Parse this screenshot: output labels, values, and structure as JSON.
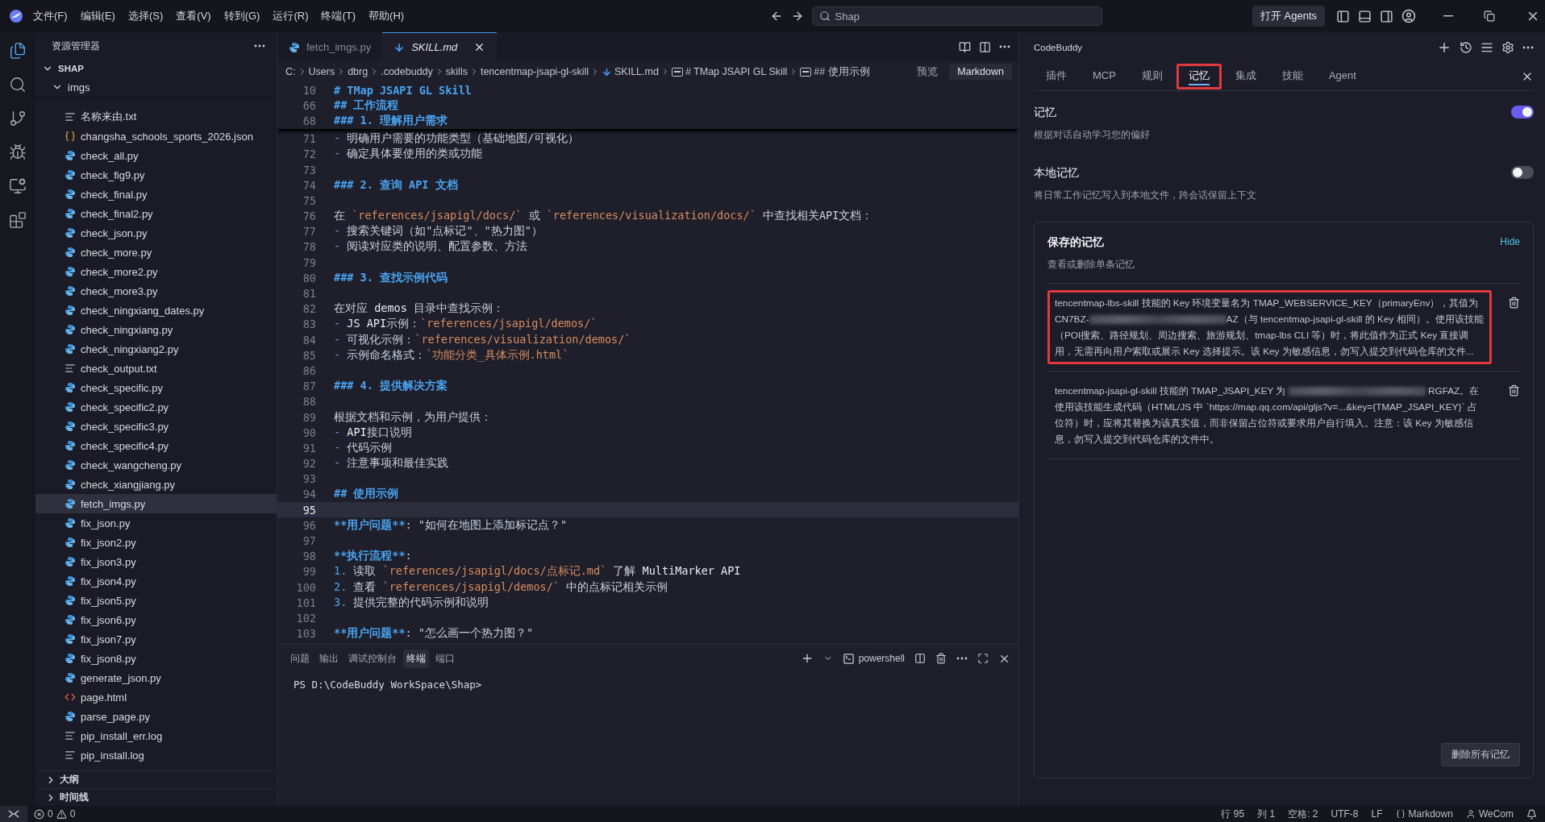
{
  "title_bar": {
    "menu": [
      "文件(F)",
      "编辑(E)",
      "选择(S)",
      "查看(V)",
      "转到(G)",
      "运行(R)",
      "终端(T)",
      "帮助(H)"
    ],
    "search": "Shap",
    "agents_button": "打开 Agents"
  },
  "activity_bar": [
    {
      "kind": "explorer",
      "selected": true
    },
    {
      "kind": "search",
      "selected": false
    },
    {
      "kind": "source-control",
      "selected": false
    },
    {
      "kind": "debug",
      "selected": false
    },
    {
      "kind": "remote",
      "selected": false
    },
    {
      "kind": "extensions",
      "selected": false
    }
  ],
  "explorer": {
    "title": "资源管理器",
    "root": {
      "label": "SHAP",
      "expanded": true
    },
    "folder": {
      "label": "imgs",
      "expanded": true
    },
    "files": [
      {
        "name": "名称来由.txt",
        "kind": "txt",
        "selected": false
      },
      {
        "name": "changsha_schools_sports_2026.json",
        "kind": "json",
        "selected": false
      },
      {
        "name": "check_all.py",
        "kind": "py",
        "selected": false
      },
      {
        "name": "check_fig9.py",
        "kind": "py",
        "selected": false
      },
      {
        "name": "check_final.py",
        "kind": "py",
        "selected": false
      },
      {
        "name": "check_final2.py",
        "kind": "py",
        "selected": false
      },
      {
        "name": "check_json.py",
        "kind": "py",
        "selected": false
      },
      {
        "name": "check_more.py",
        "kind": "py",
        "selected": false
      },
      {
        "name": "check_more2.py",
        "kind": "py",
        "selected": false
      },
      {
        "name": "check_more3.py",
        "kind": "py",
        "selected": false
      },
      {
        "name": "check_ningxiang_dates.py",
        "kind": "py",
        "selected": false
      },
      {
        "name": "check_ningxiang.py",
        "kind": "py",
        "selected": false
      },
      {
        "name": "check_ningxiang2.py",
        "kind": "py",
        "selected": false
      },
      {
        "name": "check_output.txt",
        "kind": "txt",
        "selected": false
      },
      {
        "name": "check_specific.py",
        "kind": "py",
        "selected": false
      },
      {
        "name": "check_specific2.py",
        "kind": "py",
        "selected": false
      },
      {
        "name": "check_specific3.py",
        "kind": "py",
        "selected": false
      },
      {
        "name": "check_specific4.py",
        "kind": "py",
        "selected": false
      },
      {
        "name": "check_wangcheng.py",
        "kind": "py",
        "selected": false
      },
      {
        "name": "check_xiangjiang.py",
        "kind": "py",
        "selected": false
      },
      {
        "name": "fetch_imgs.py",
        "kind": "py",
        "selected": true
      },
      {
        "name": "fix_json.py",
        "kind": "py",
        "selected": false
      },
      {
        "name": "fix_json2.py",
        "kind": "py",
        "selected": false
      },
      {
        "name": "fix_json3.py",
        "kind": "py",
        "selected": false
      },
      {
        "name": "fix_json4.py",
        "kind": "py",
        "selected": false
      },
      {
        "name": "fix_json5.py",
        "kind": "py",
        "selected": false
      },
      {
        "name": "fix_json6.py",
        "kind": "py",
        "selected": false
      },
      {
        "name": "fix_json7.py",
        "kind": "py",
        "selected": false
      },
      {
        "name": "fix_json8.py",
        "kind": "py",
        "selected": false
      },
      {
        "name": "generate_json.py",
        "kind": "py",
        "selected": false
      },
      {
        "name": "page.html",
        "kind": "html",
        "selected": false
      },
      {
        "name": "parse_page.py",
        "kind": "py",
        "selected": false
      },
      {
        "name": "pip_install_err.log",
        "kind": "txt",
        "selected": false
      },
      {
        "name": "pip_install.log",
        "kind": "txt",
        "selected": false
      }
    ],
    "sections": [
      {
        "label": "大纲",
        "expanded": false
      },
      {
        "label": "时间线",
        "expanded": false
      }
    ]
  },
  "editor": {
    "tabs": [
      {
        "label": "fetch_imgs.py",
        "kind": "py",
        "selected": false
      },
      {
        "label": "SKILL.md",
        "kind": "md",
        "selected": true
      }
    ],
    "breadcrumb": [
      {
        "label": "C:",
        "kind": "plain"
      },
      {
        "label": "Users",
        "kind": "plain"
      },
      {
        "label": "dbrg",
        "kind": "plain"
      },
      {
        "label": ".codebuddy",
        "kind": "plain"
      },
      {
        "label": "skills",
        "kind": "plain"
      },
      {
        "label": "tencentmap-jsapi-gl-skill",
        "kind": "plain"
      },
      {
        "label": "SKILL.md",
        "kind": "md"
      },
      {
        "label": "# TMap JSAPI GL Skill",
        "kind": "symbol"
      },
      {
        "label": "## 使用示例",
        "kind": "symbol"
      }
    ],
    "preview_link": "预览",
    "mode_button": "Markdown",
    "sticky_lines": [
      {
        "number": "10",
        "segments": [
          {
            "kind": "heading",
            "text": "# TMap JSAPI GL Skill"
          }
        ]
      },
      {
        "number": "66",
        "segments": [
          {
            "kind": "heading",
            "text": "## 工作流程"
          }
        ]
      },
      {
        "number": "68",
        "segments": [
          {
            "kind": "heading",
            "text": "### 1. 理解用户需求"
          }
        ]
      }
    ],
    "lines": [
      {
        "number": "71",
        "segments": [
          {
            "kind": "marker",
            "text": "- "
          },
          {
            "kind": "plain",
            "text": "明确用户需要的功能类型（基础地图/可视化）"
          }
        ]
      },
      {
        "number": "72",
        "segments": [
          {
            "kind": "marker",
            "text": "- "
          },
          {
            "kind": "plain",
            "text": "确定具体要使用的类或功能"
          }
        ]
      },
      {
        "number": "73"
      },
      {
        "number": "74",
        "segments": [
          {
            "kind": "heading",
            "text": "### 2. 查询 API 文档"
          }
        ]
      },
      {
        "number": "75"
      },
      {
        "number": "76",
        "segments": [
          {
            "kind": "plain",
            "text": "在 "
          },
          {
            "kind": "code",
            "text": "`references/jsapigl/docs/`"
          },
          {
            "kind": "plain",
            "text": " 或 "
          },
          {
            "kind": "code",
            "text": "`references/visualization/docs/`"
          },
          {
            "kind": "plain",
            "text": " 中查找相关API文档："
          }
        ]
      },
      {
        "number": "77",
        "segments": [
          {
            "kind": "marker",
            "text": "- "
          },
          {
            "kind": "plain",
            "text": "搜索关键词（如\"点标记\"、\"热力图\"）"
          }
        ]
      },
      {
        "number": "78",
        "segments": [
          {
            "kind": "marker",
            "text": "- "
          },
          {
            "kind": "plain",
            "text": "阅读对应类的说明、配置参数、方法"
          }
        ]
      },
      {
        "number": "79"
      },
      {
        "number": "80",
        "segments": [
          {
            "kind": "heading",
            "text": "### 3. 查找示例代码"
          }
        ]
      },
      {
        "number": "81"
      },
      {
        "number": "82",
        "segments": [
          {
            "kind": "plain",
            "text": "在对应 "
          },
          {
            "kind": "mono",
            "text": "demos"
          },
          {
            "kind": "plain",
            "text": " 目录中查找示例："
          }
        ]
      },
      {
        "number": "83",
        "segments": [
          {
            "kind": "marker",
            "text": "- "
          },
          {
            "kind": "mono",
            "text": "JS API"
          },
          {
            "kind": "plain",
            "text": "示例："
          },
          {
            "kind": "code",
            "text": "`references/jsapigl/demos/`"
          }
        ]
      },
      {
        "number": "84",
        "segments": [
          {
            "kind": "marker",
            "text": "- "
          },
          {
            "kind": "plain",
            "text": "可视化示例："
          },
          {
            "kind": "code",
            "text": "`references/visualization/demos/`"
          }
        ]
      },
      {
        "number": "85",
        "segments": [
          {
            "kind": "marker",
            "text": "- "
          },
          {
            "kind": "plain",
            "text": "示例命名格式："
          },
          {
            "kind": "code",
            "text": "`功能分类_具体示例.html`"
          }
        ]
      },
      {
        "number": "86"
      },
      {
        "number": "87",
        "segments": [
          {
            "kind": "heading",
            "text": "### 4. 提供解决方案"
          }
        ]
      },
      {
        "number": "88"
      },
      {
        "number": "89",
        "segments": [
          {
            "kind": "plain",
            "text": "根据文档和示例，为用户提供："
          }
        ]
      },
      {
        "number": "90",
        "segments": [
          {
            "kind": "marker",
            "text": "- "
          },
          {
            "kind": "mono",
            "text": "API"
          },
          {
            "kind": "plain",
            "text": "接口说明"
          }
        ]
      },
      {
        "number": "91",
        "segments": [
          {
            "kind": "marker",
            "text": "- "
          },
          {
            "kind": "plain",
            "text": "代码示例"
          }
        ]
      },
      {
        "number": "92",
        "segments": [
          {
            "kind": "marker",
            "text": "- "
          },
          {
            "kind": "plain",
            "text": "注意事项和最佳实践"
          }
        ]
      },
      {
        "number": "93"
      },
      {
        "number": "94",
        "segments": [
          {
            "kind": "heading",
            "text": "## 使用示例"
          }
        ]
      },
      {
        "number": "95",
        "current": true
      },
      {
        "number": "96",
        "segments": [
          {
            "kind": "bold",
            "text": "**用户问题**"
          },
          {
            "kind": "plain",
            "text": ": \"如何在地图上添加标记点？\""
          }
        ]
      },
      {
        "number": "97"
      },
      {
        "number": "98",
        "segments": [
          {
            "kind": "bold",
            "text": "**执行流程**"
          },
          {
            "kind": "plain",
            "text": ":"
          }
        ]
      },
      {
        "number": "99",
        "segments": [
          {
            "kind": "marker",
            "text": "1. "
          },
          {
            "kind": "plain",
            "text": "读取 "
          },
          {
            "kind": "code",
            "text": "`references/jsapigl/docs/点标记.md`"
          },
          {
            "kind": "plain",
            "text": " 了解 "
          },
          {
            "kind": "mono",
            "text": "MultiMarker API"
          }
        ]
      },
      {
        "number": "100",
        "segments": [
          {
            "kind": "marker",
            "text": "2. "
          },
          {
            "kind": "plain",
            "text": "查看 "
          },
          {
            "kind": "code",
            "text": "`references/jsapigl/demos/`"
          },
          {
            "kind": "plain",
            "text": " 中的点标记相关示例"
          }
        ]
      },
      {
        "number": "101",
        "segments": [
          {
            "kind": "marker",
            "text": "3. "
          },
          {
            "kind": "plain",
            "text": "提供完整的代码示例和说明"
          }
        ]
      },
      {
        "number": "102"
      },
      {
        "number": "103",
        "segments": [
          {
            "kind": "bold",
            "text": "**用户问题**"
          },
          {
            "kind": "plain",
            "text": ": \"怎么画一个热力图？\""
          }
        ]
      }
    ]
  },
  "panel": {
    "tabs": [
      {
        "label": "问题",
        "selected": false
      },
      {
        "label": "输出",
        "selected": false
      },
      {
        "label": "调试控制台",
        "selected": false
      },
      {
        "label": "终端",
        "selected": true
      },
      {
        "label": "端口",
        "selected": false
      }
    ],
    "shell": "powershell",
    "prompt": "PS D:\\CodeBuddy WorkSpace\\Shap>"
  },
  "codebuddy": {
    "title": "CodeBuddy",
    "tabs": [
      {
        "label": "插件",
        "selected": false,
        "annotated": false
      },
      {
        "label": "MCP",
        "selected": false,
        "annotated": false
      },
      {
        "label": "规则",
        "selected": false,
        "annotated": false
      },
      {
        "label": "记忆",
        "selected": true,
        "annotated": true
      },
      {
        "label": "集成",
        "selected": false,
        "annotated": false
      },
      {
        "label": "技能",
        "selected": false,
        "annotated": false
      },
      {
        "label": "Agent",
        "selected": false,
        "annotated": false
      }
    ],
    "settings": [
      {
        "title": "记忆",
        "description": "根据对话自动学习您的偏好",
        "on": true
      },
      {
        "title": "本地记忆",
        "description": "将日常工作记忆写入到本地文件，跨会话保留上下文",
        "on": false
      }
    ],
    "saved": {
      "title": "保存的记忆",
      "subtitle": "查看或删除单条记忆",
      "toggle_link": "Hide",
      "items": [
        {
          "annotated": true,
          "parts": [
            {
              "kind": "text",
              "text": "tencentmap-lbs-skill 技能的 Key 环境变量名为 TMAP_WEBSERVICE_KEY（primaryEnv），其值为 CN7BZ-"
            },
            {
              "kind": "redacted"
            },
            {
              "kind": "text",
              "text": "AZ（与 tencentmap-jsapi-gl-skill 的 Key 相同）。使用该技能（POI搜索、路径规划、周边搜索、旅游规划、tmap-lbs CLI 等）时，将此值作为正式 Key 直接调用，无需再向用户索取或展示 Key 选择提示。该 Key 为敏感信息，勿写入提交到代码仓库的文件..."
            }
          ]
        },
        {
          "annotated": false,
          "parts": [
            {
              "kind": "text",
              "text": "tencentmap-jsapi-gl-skill 技能的 TMAP_JSAPI_KEY 为 "
            },
            {
              "kind": "redacted"
            },
            {
              "kind": "text",
              "text": " RGFAZ。在使用该技能生成代码（HTML/JS 中 `https://map.qq.com/api/gljs?v=...&key={TMAP_JSAPI_KEY}` 占位符）时，应将其替换为该真实值，而非保留占位符或要求用户自行填入。注意：该 Key 为敏感信息，勿写入提交到代码仓库的文件中。"
            }
          ]
        }
      ],
      "delete_all": "删除所有记忆"
    }
  },
  "status_bar": {
    "errors": "0",
    "warnings": "0",
    "items": [
      {
        "kind": "text",
        "label": "行 95"
      },
      {
        "kind": "text",
        "label": "列 1"
      },
      {
        "kind": "text",
        "label": "空格: 2"
      },
      {
        "kind": "text",
        "label": "UTF-8"
      },
      {
        "kind": "text",
        "label": "LF"
      },
      {
        "kind": "language",
        "label": "Markdown"
      },
      {
        "kind": "account",
        "label": "WeCom"
      }
    ]
  }
}
